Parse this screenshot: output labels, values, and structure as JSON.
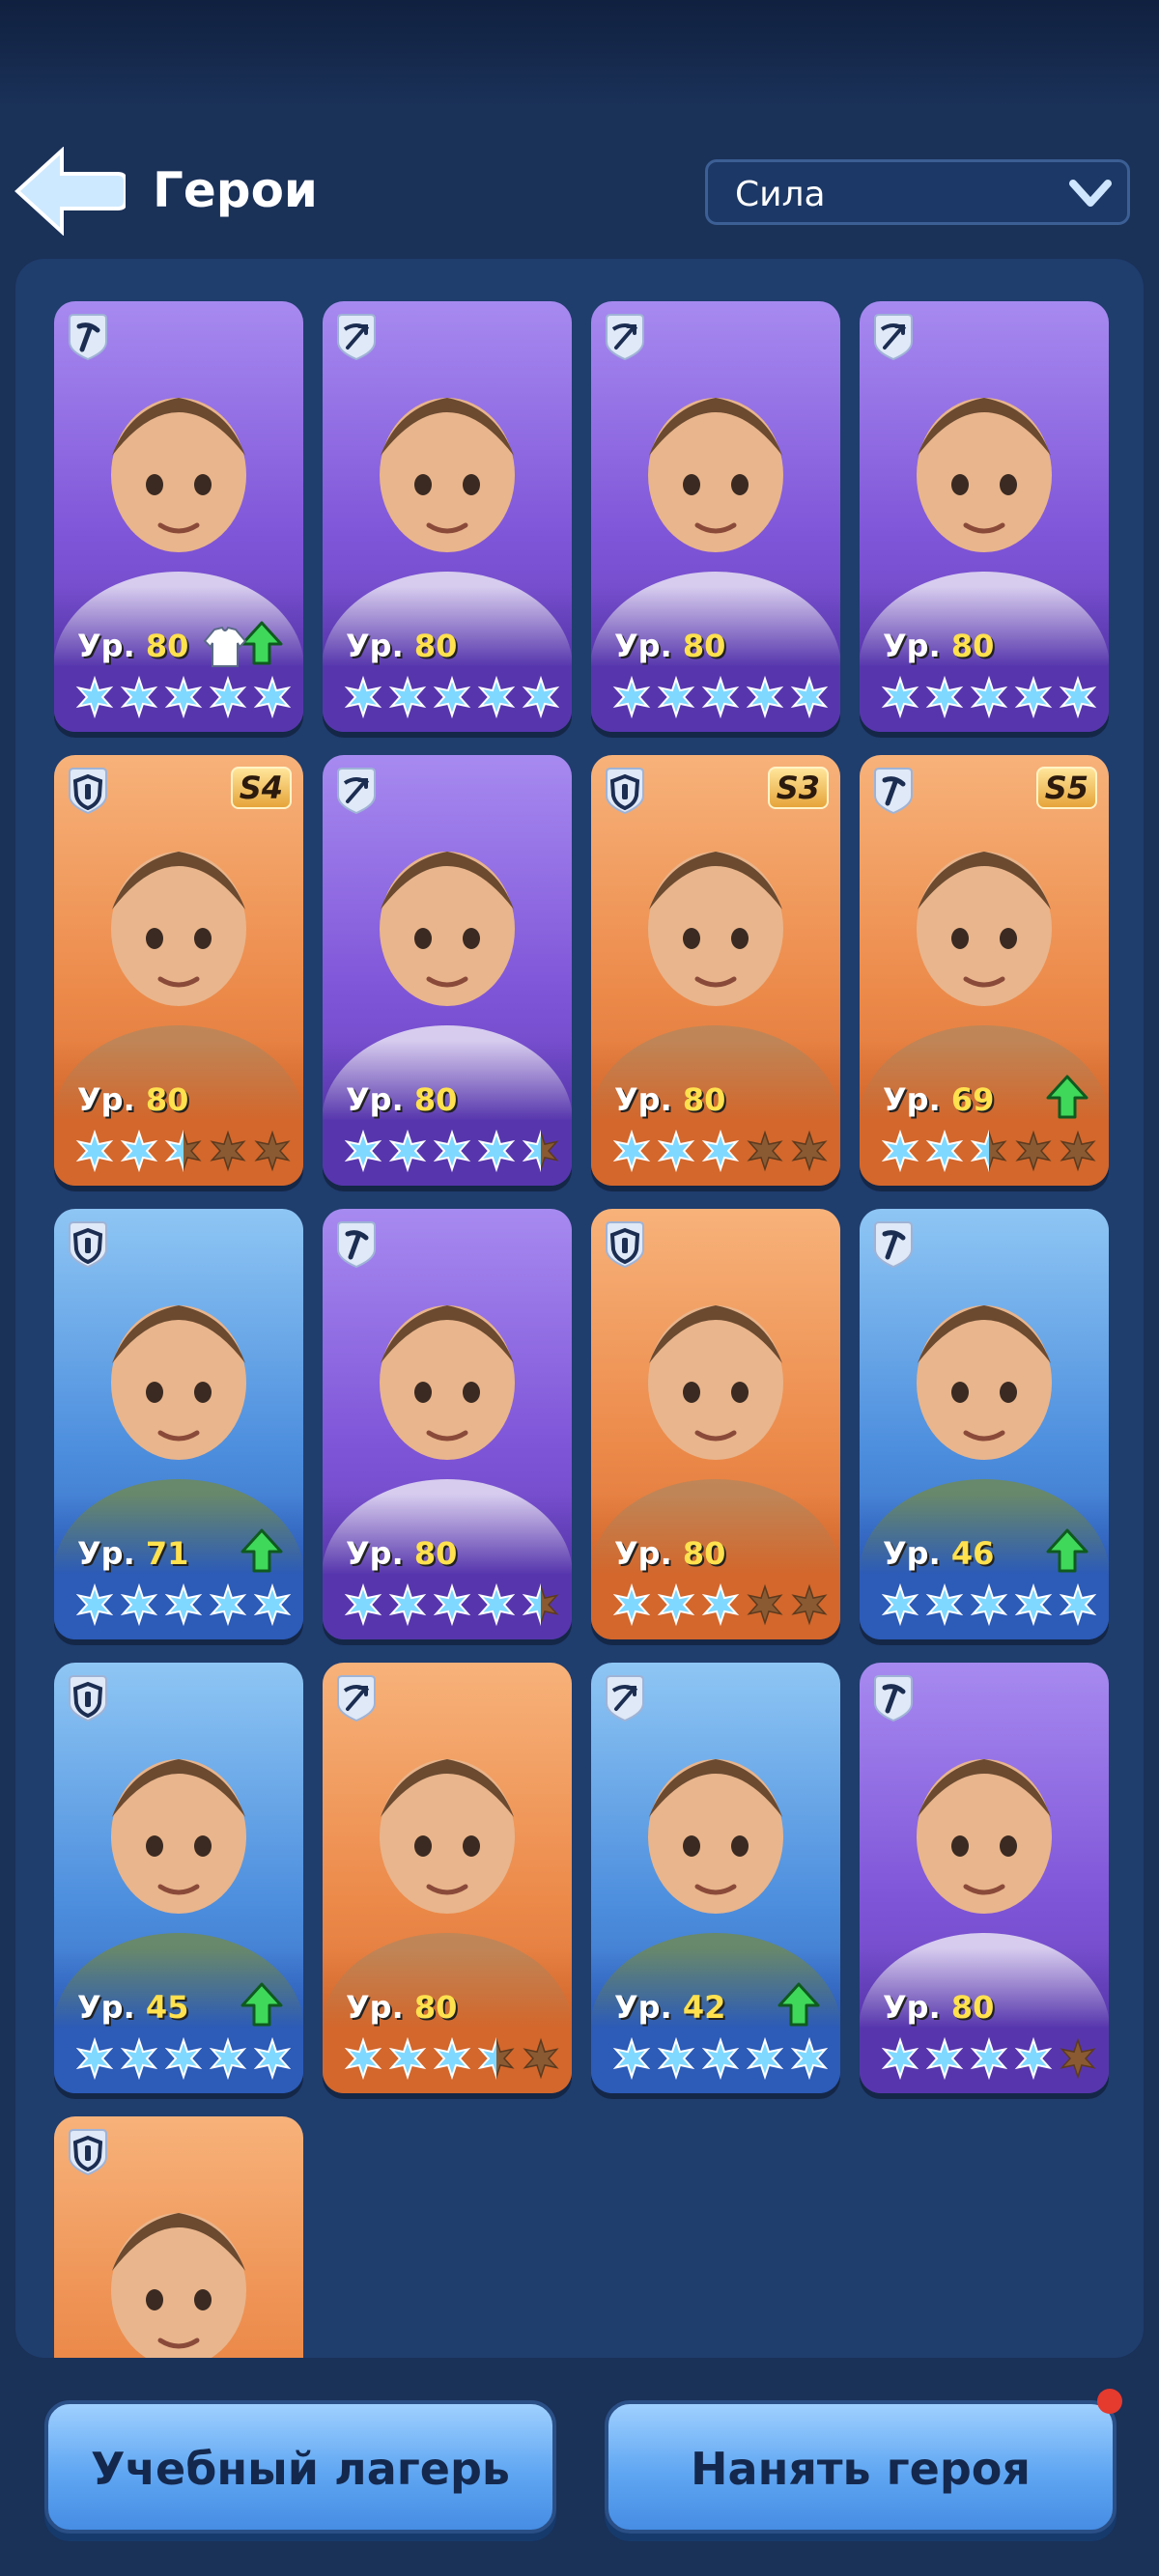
{
  "header": {
    "title": "Герои",
    "sort_label": "Сила"
  },
  "level_prefix": "Ур.",
  "heroes": [
    {
      "level": "80",
      "class": "pickaxe",
      "rarity": "purple",
      "stars": 5,
      "upgrade": true,
      "gear_upgrade": true,
      "tier": ""
    },
    {
      "level": "80",
      "class": "crossbow",
      "rarity": "purple",
      "stars": 5,
      "upgrade": false,
      "tier": ""
    },
    {
      "level": "80",
      "class": "crossbow",
      "rarity": "purple",
      "stars": 5,
      "upgrade": false,
      "tier": ""
    },
    {
      "level": "80",
      "class": "crossbow",
      "rarity": "purple",
      "stars": 5,
      "upgrade": false,
      "tier": ""
    },
    {
      "level": "80",
      "class": "shield",
      "rarity": "orange",
      "stars": 2.5,
      "upgrade": false,
      "tier": "S4"
    },
    {
      "level": "80",
      "class": "crossbow",
      "rarity": "purple",
      "stars": 4.5,
      "upgrade": false,
      "tier": ""
    },
    {
      "level": "80",
      "class": "shield",
      "rarity": "orange",
      "stars": 3,
      "upgrade": false,
      "tier": "S3"
    },
    {
      "level": "69",
      "class": "pickaxe",
      "rarity": "orange",
      "stars": 2.5,
      "upgrade": true,
      "tier": "S5"
    },
    {
      "level": "71",
      "class": "shield",
      "rarity": "blue",
      "stars": 5,
      "upgrade": true,
      "tier": ""
    },
    {
      "level": "80",
      "class": "pickaxe",
      "rarity": "purple",
      "stars": 4.5,
      "upgrade": false,
      "tier": ""
    },
    {
      "level": "80",
      "class": "shield",
      "rarity": "orange",
      "stars": 3,
      "upgrade": false,
      "tier": ""
    },
    {
      "level": "46",
      "class": "pickaxe",
      "rarity": "blue",
      "stars": 5,
      "upgrade": true,
      "tier": ""
    },
    {
      "level": "45",
      "class": "shield",
      "rarity": "blue",
      "stars": 5,
      "upgrade": true,
      "tier": ""
    },
    {
      "level": "80",
      "class": "crossbow",
      "rarity": "orange",
      "stars": 3.5,
      "upgrade": false,
      "tier": ""
    },
    {
      "level": "42",
      "class": "crossbow",
      "rarity": "blue",
      "stars": 5,
      "upgrade": true,
      "tier": ""
    },
    {
      "level": "80",
      "class": "pickaxe",
      "rarity": "purple",
      "stars": 4,
      "upgrade": false,
      "tier": ""
    },
    {
      "level": "",
      "class": "shield",
      "rarity": "orange",
      "stars": 0,
      "upgrade": false,
      "tier": ""
    }
  ],
  "buttons": {
    "training_camp": "Учебный лагерь",
    "hire_hero": "Нанять героя"
  },
  "colors": {
    "star_filled": "#7fd8ff",
    "star_empty": "#8a5a33",
    "level_number": "#ffe14e",
    "upgrade_arrow": "#3fd85a",
    "notification_dot": "#e53a2e"
  }
}
